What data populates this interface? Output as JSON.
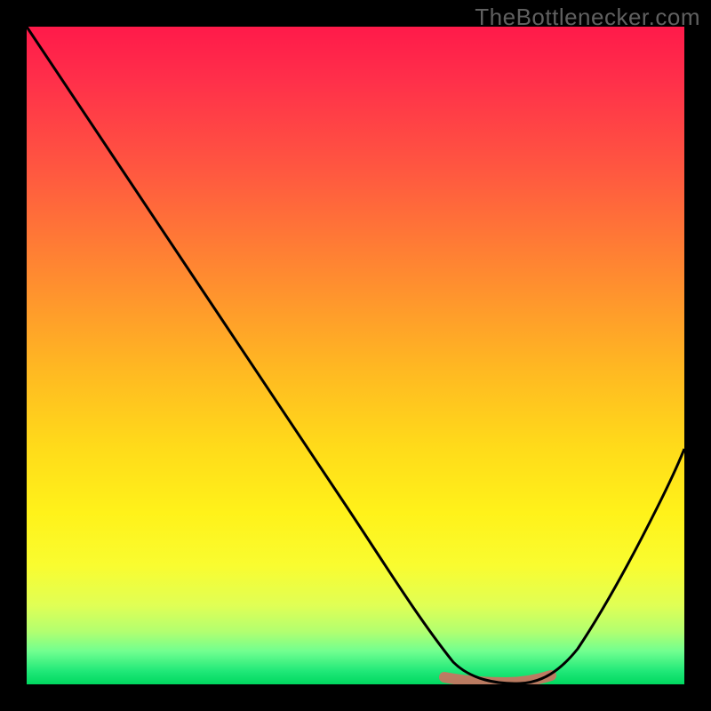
{
  "watermark": "TheBottlenecker.com",
  "chart_data": {
    "type": "line",
    "title": "",
    "xlabel": "",
    "ylabel": "",
    "xlim": [
      0,
      100
    ],
    "ylim": [
      0,
      100
    ],
    "series": [
      {
        "name": "bottleneck-curve",
        "x": [
          0,
          6,
          12,
          18,
          24,
          30,
          36,
          42,
          48,
          54,
          60,
          64,
          68,
          72,
          76,
          80,
          84,
          88,
          92,
          96,
          100
        ],
        "y": [
          100,
          92,
          83,
          74,
          65,
          56,
          47,
          38,
          29,
          20,
          11,
          5,
          1,
          0,
          0,
          2,
          8,
          16,
          25,
          34,
          44
        ]
      }
    ],
    "annotations": [
      {
        "name": "optimal-range",
        "x_start": 64,
        "x_end": 80,
        "y": 0.8
      }
    ],
    "background": {
      "type": "vertical-gradient",
      "stops": [
        {
          "pos": 0,
          "color": "#ff1a4a"
        },
        {
          "pos": 50,
          "color": "#ffcc20"
        },
        {
          "pos": 85,
          "color": "#f0ff40"
        },
        {
          "pos": 100,
          "color": "#00d860"
        }
      ],
      "meaning": "top=high bottleneck (bad), bottom=low bottleneck (good)"
    }
  }
}
